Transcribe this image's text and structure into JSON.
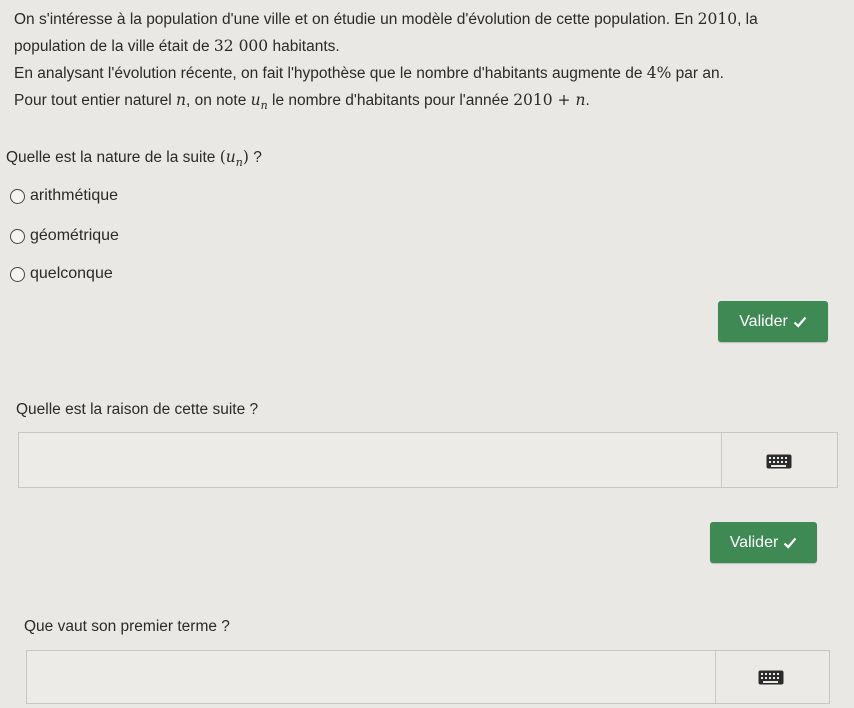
{
  "intro": {
    "line1a": "On s'intéresse à la population d'une ville et on étudie un modèle d'évolution de cette population. En ",
    "line1year": "2010",
    "line1b": ", la",
    "line2a": "population de la ville était de ",
    "line2num": "32 000",
    "line2b": " habitants.",
    "line3a": "En analysant l'évolution récente, on fait l'hypothèse que le nombre d'habitants augmente de ",
    "line3pct": "4%",
    "line3b": " par an.",
    "line4a": "Pour tout entier naturel ",
    "line4n": "n",
    "line4b": ", on note ",
    "line4u": "u",
    "line4sub": "n",
    "line4c": " le nombre d'habitants pour l'année ",
    "line4expr": "2010 + ",
    "line4n2": "n",
    "line4d": "."
  },
  "q1": {
    "prefix": "Quelle est la nature de la suite ",
    "lparen": "(",
    "u": "u",
    "sub": "n",
    "rparen": ")",
    "suffix": " ?",
    "options": [
      "arithmétique",
      "géométrique",
      "quelconque"
    ],
    "submit_label": "Valider"
  },
  "q2": {
    "text": "Quelle est la raison de cette suite ?",
    "value": "",
    "submit_label": "Valider"
  },
  "q3": {
    "text": "Que vaut son premier terme ?",
    "value": ""
  },
  "colors": {
    "button": "#3f8a54",
    "background": "#e9e8e4"
  },
  "icons": {
    "submit": "check-icon",
    "keyboard": "keyboard-icon"
  }
}
